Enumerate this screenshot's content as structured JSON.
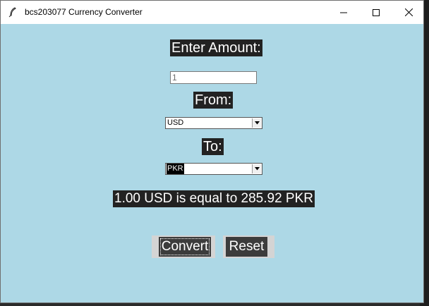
{
  "window": {
    "title": "bcs203077 Currency Converter",
    "app_icon": "feather-icon",
    "controls": [
      "minimize-icon",
      "maximize-icon",
      "close-icon"
    ],
    "background": "#add8e6"
  },
  "form": {
    "amount_label": "Enter Amount:",
    "amount_value": "1",
    "from_label": "From:",
    "from_value": "USD",
    "to_label": "To:",
    "to_value": "PKR",
    "result_text": "1.00 USD is equal to 285.92 PKR"
  },
  "buttons": {
    "convert_label": "Convert",
    "reset_label": "Reset"
  }
}
